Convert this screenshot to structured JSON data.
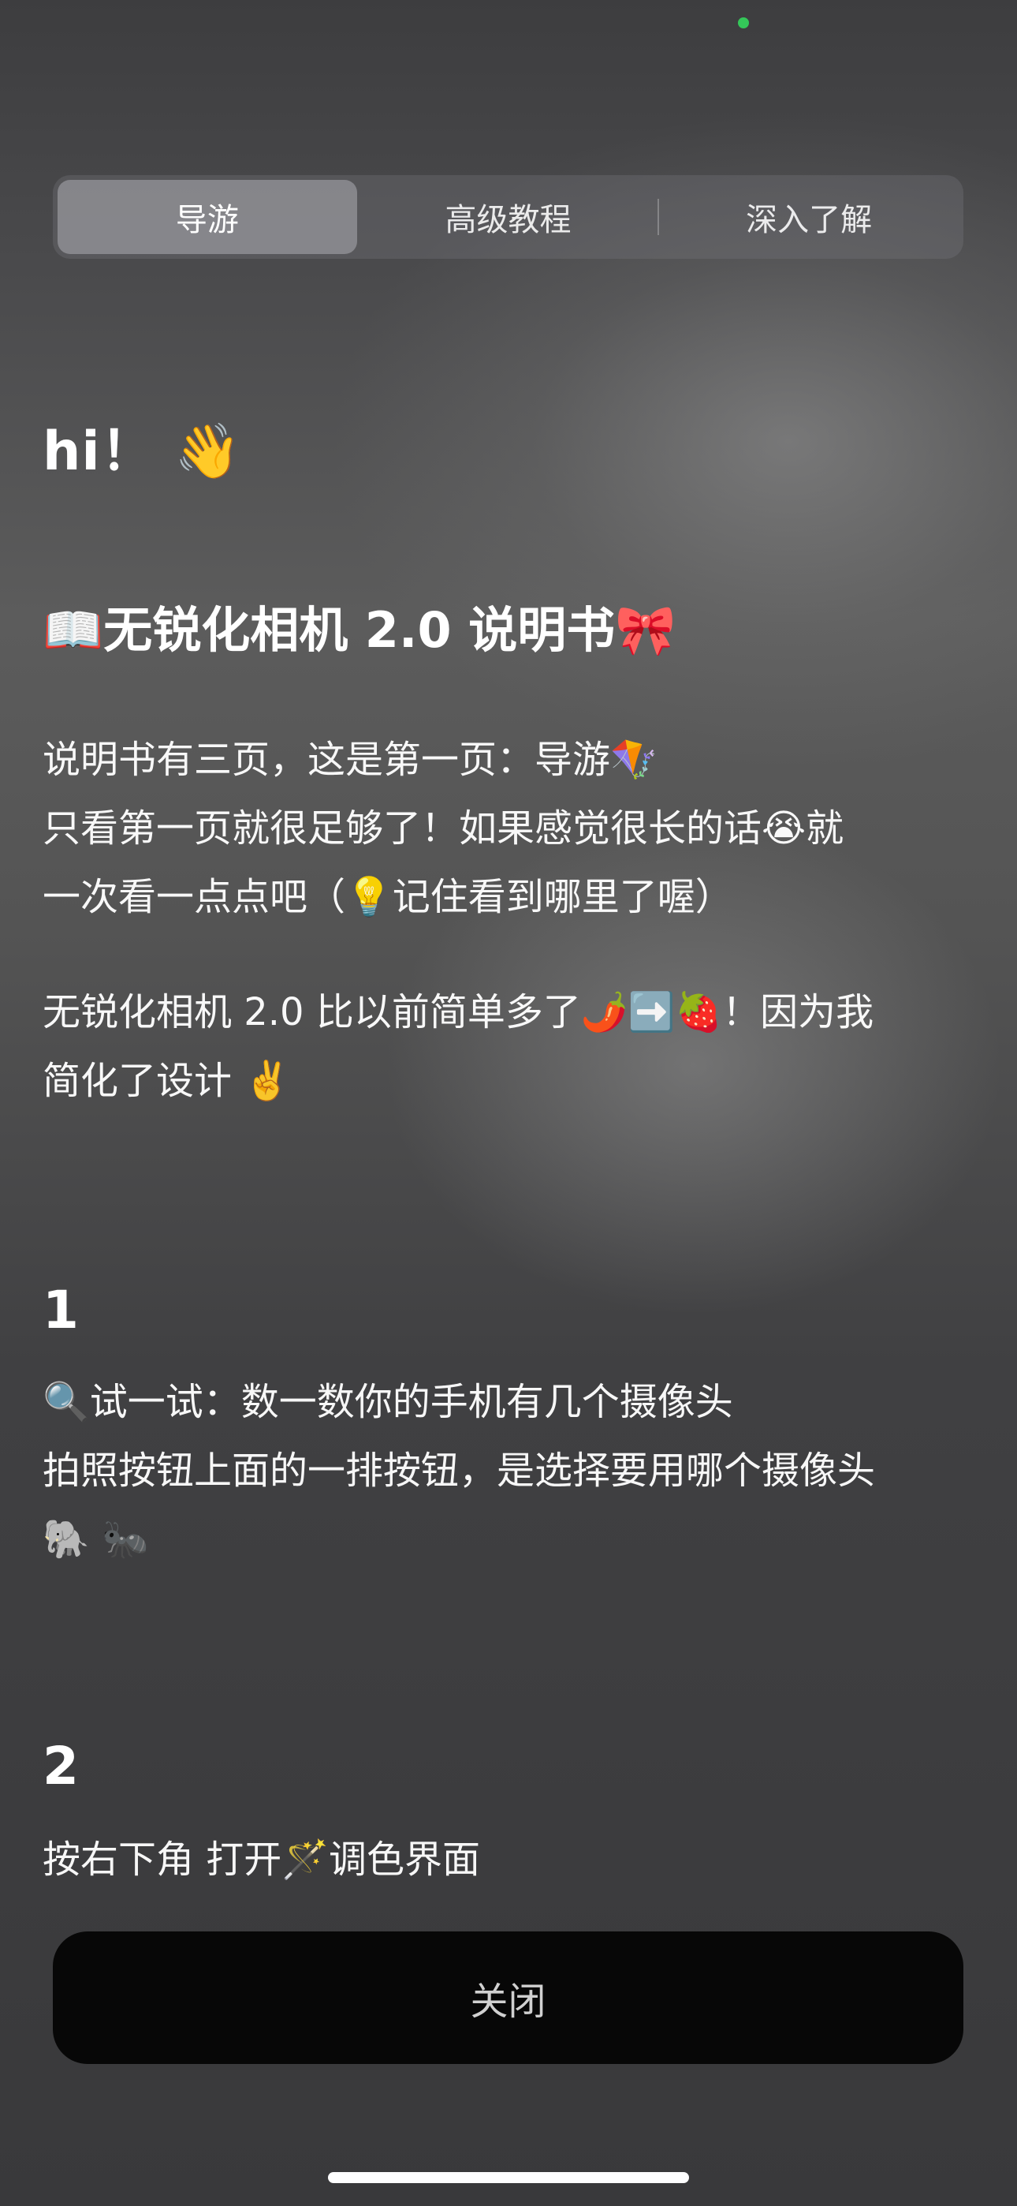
{
  "tabs": [
    {
      "label": "导游",
      "active": true
    },
    {
      "label": "高级教程",
      "active": false
    },
    {
      "label": "深入了解",
      "active": false
    }
  ],
  "greeting": "hi！ 👋",
  "title": "📖无锐化相机 2.0 说明书🎀",
  "intro": {
    "lines": [
      "说明书有三页，这是第一页：导游🪁",
      "只看第一页就很足够了！如果感觉很长的话😭就",
      "一次看一点点吧（💡记住看到哪里了喔）"
    ]
  },
  "simplify": {
    "lines": [
      "无锐化相机 2.0 比以前简单多了🌶️➡️🍓！因为我",
      "简化了设计 ✌️"
    ]
  },
  "steps": [
    {
      "number": "1",
      "lines": [
        "🔍试一试：数一数你的手机有几个摄像头",
        "拍照按钮上面的一排按钮，是选择要用哪个摄像头",
        "🐘 🐜"
      ]
    },
    {
      "number": "2",
      "lines": [
        "按右下角 打开🪄调色界面"
      ]
    }
  ],
  "close_button": "关闭",
  "colors": {
    "camera_indicator": "#34c759",
    "close_button_bg": "#070707"
  }
}
